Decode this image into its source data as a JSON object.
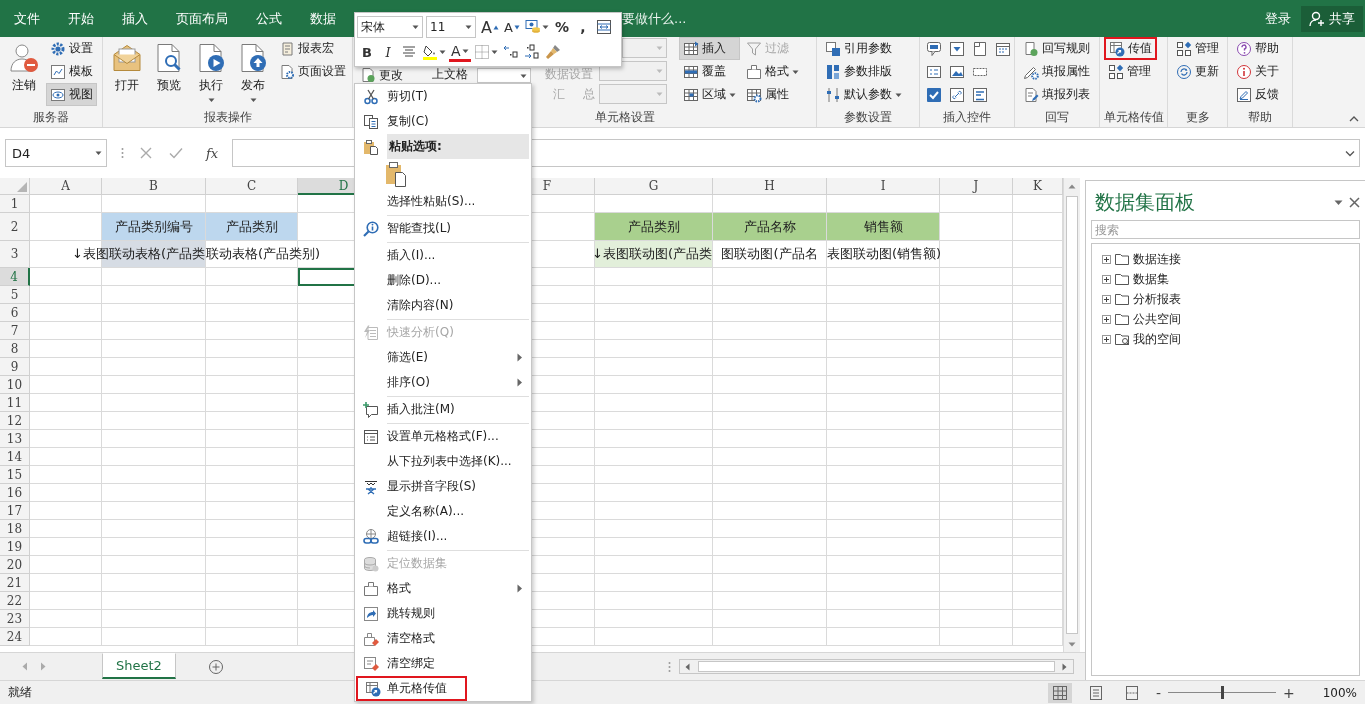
{
  "title_bar": {
    "tabs": [
      {
        "label": "文件",
        "selected": false
      },
      {
        "label": "开始",
        "selected": false
      },
      {
        "label": "插入",
        "selected": false
      },
      {
        "label": "页面布局",
        "selected": false
      },
      {
        "label": "公式",
        "selected": false
      },
      {
        "label": "数据",
        "selected": false
      }
    ],
    "tell_me": "要做什么...",
    "sign_in": "登录",
    "share": "共享"
  },
  "ribbon": {
    "groups": [
      {
        "kind": "buttons",
        "label": "服务器",
        "columns": [
          {
            "kind": "large",
            "buttons": [
              {
                "text": "注销",
                "pressed": false,
                "dropdown": false
              }
            ]
          },
          {
            "kind": "small",
            "buttons": [
              {
                "text": "设置",
                "pressed": false,
                "dropdown": false
              },
              {
                "text": "模板",
                "pressed": false,
                "dropdown": false
              },
              {
                "text": "视图",
                "pressed": true,
                "dropdown": false
              }
            ]
          }
        ]
      },
      {
        "kind": "buttons",
        "label": "报表操作",
        "columns": [
          {
            "kind": "large",
            "buttons": [
              {
                "text": "打开",
                "pressed": false,
                "dropdown": false
              }
            ]
          },
          {
            "kind": "large",
            "buttons": [
              {
                "text": "预览",
                "pressed": false,
                "dropdown": false
              }
            ]
          },
          {
            "kind": "large",
            "buttons": [
              {
                "text": "执行",
                "pressed": false,
                "dropdown": true
              }
            ]
          },
          {
            "kind": "large",
            "buttons": [
              {
                "text": "发布",
                "pressed": false,
                "dropdown": true
              }
            ]
          },
          {
            "kind": "small",
            "buttons": [
              {
                "text": "报表宏",
                "pressed": false,
                "dropdown": false
              },
              {
                "text": "页面设置",
                "pressed": false,
                "dropdown": false
              }
            ]
          }
        ]
      },
      {
        "kind": "fields",
        "label": "单元格设置",
        "fields": [
          {
            "kind": "button",
            "text": "更改",
            "disabled": false
          },
          {
            "kind": "label",
            "text": "上文格",
            "disabled": false
          },
          {
            "kind": "dropdown",
            "disabled": false
          },
          {
            "kind": "label",
            "text": "数据设置",
            "disabled": true
          },
          {
            "kind": "label",
            "text": "汇",
            "disabled": true
          },
          {
            "kind": "label",
            "text": "总",
            "disabled": true
          },
          {
            "kind": "dropdown",
            "disabled": true
          },
          {
            "kind": "dropdown",
            "disabled": true
          },
          {
            "kind": "dropdown",
            "disabled": true
          }
        ],
        "columns": [
          {
            "kind": "small",
            "buttons": [
              {
                "text": "插入",
                "pressed": true,
                "dropdown": false
              },
              {
                "text": "覆盖",
                "pressed": false,
                "dropdown": false
              },
              {
                "text": "区域",
                "pressed": false,
                "dropdown": true
              }
            ]
          },
          {
            "kind": "small",
            "buttons": [
              {
                "text": "过滤",
                "pressed": false,
                "dropdown": false,
                "disabled": true
              },
              {
                "text": "格式",
                "pressed": false,
                "dropdown": true,
                "disabled": false
              },
              {
                "text": "属性",
                "pressed": false,
                "dropdown": false,
                "disabled": false
              }
            ]
          }
        ]
      },
      {
        "kind": "buttons",
        "label": "参数设置",
        "columns": [
          {
            "kind": "small",
            "buttons": [
              {
                "text": "引用参数",
                "pressed": false,
                "dropdown": false
              },
              {
                "text": "参数排版",
                "pressed": false,
                "dropdown": false
              },
              {
                "text": "默认参数",
                "pressed": false,
                "dropdown": true
              }
            ]
          }
        ]
      },
      {
        "kind": "buttons",
        "label": "插入控件",
        "columns": [
          {
            "kind": "icons",
            "buttons": [
              {
                "pressed": false
              },
              {
                "pressed": false
              },
              {
                "pressed": false
              }
            ]
          },
          {
            "kind": "icons",
            "buttons": [
              {
                "pressed": false
              },
              {
                "pressed": false
              },
              {
                "pressed": false
              }
            ]
          },
          {
            "kind": "icons",
            "buttons": [
              {
                "pressed": false
              },
              {
                "pressed": false
              },
              {
                "pressed": false
              }
            ]
          },
          {
            "kind": "icons",
            "buttons": [
              {
                "pressed": false
              }
            ]
          }
        ]
      },
      {
        "kind": "buttons",
        "label": "回写",
        "columns": [
          {
            "kind": "small",
            "buttons": [
              {
                "text": "回写规则",
                "pressed": false,
                "dropdown": false
              },
              {
                "text": "填报属性",
                "pressed": false,
                "dropdown": false
              },
              {
                "text": "填报列表",
                "pressed": false,
                "dropdown": false
              }
            ]
          }
        ]
      },
      {
        "kind": "buttons",
        "label": "单元格传值",
        "columns": [
          {
            "kind": "small",
            "buttons": [
              {
                "text": "传值",
                "pressed": false,
                "dropdown": false,
                "highlighted": true
              },
              {
                "text": "管理",
                "pressed": false,
                "dropdown": false,
                "highlighted": false
              }
            ]
          }
        ]
      },
      {
        "kind": "buttons",
        "label": "更多",
        "columns": [
          {
            "kind": "small",
            "buttons": [
              {
                "text": "管理",
                "pressed": false,
                "dropdown": false
              },
              {
                "text": "更新",
                "pressed": false,
                "dropdown": false
              }
            ]
          }
        ]
      },
      {
        "kind": "buttons",
        "label": "帮助",
        "columns": [
          {
            "kind": "small",
            "buttons": [
              {
                "text": "帮助",
                "pressed": false,
                "dropdown": false
              },
              {
                "text": "关于",
                "pressed": false,
                "dropdown": false
              },
              {
                "text": "反馈",
                "pressed": false,
                "dropdown": false
              }
            ]
          }
        ]
      }
    ]
  },
  "mini_toolbar": {
    "font": "宋体",
    "size": "11",
    "row_1": [
      {
        "kind": "text",
        "text": "A",
        "dropdown": false
      },
      {
        "kind": "text",
        "text": "A",
        "dropdown": false
      },
      {
        "kind": "icon",
        "dropdown": true
      },
      {
        "kind": "text",
        "text": "%",
        "dropdown": false
      },
      {
        "kind": "text",
        "text": ",",
        "dropdown": false
      },
      {
        "kind": "icon",
        "dropdown": false
      }
    ],
    "row_2": [
      {
        "kind": "text",
        "text": "B",
        "dropdown": false
      },
      {
        "kind": "text",
        "text": "I",
        "dropdown": false
      },
      {
        "kind": "icon",
        "dropdown": false
      },
      {
        "kind": "icon",
        "dropdown": true
      },
      {
        "kind": "text",
        "text": "A",
        "dropdown": true
      },
      {
        "kind": "icon",
        "dropdown": true
      },
      {
        "kind": "icon",
        "dropdown": false
      },
      {
        "kind": "icon",
        "dropdown": false
      },
      {
        "kind": "icon",
        "dropdown": false
      }
    ]
  },
  "formula_bar": {
    "name_box": "D4",
    "function_label": "fx"
  },
  "sheet": {
    "columns": [
      {
        "label": "A",
        "selected": false
      },
      {
        "label": "B",
        "selected": false
      },
      {
        "label": "C",
        "selected": false
      },
      {
        "label": "D",
        "selected": true
      },
      {
        "label": "F",
        "selected": false
      },
      {
        "label": "G",
        "selected": false
      },
      {
        "label": "H",
        "selected": false
      },
      {
        "label": "I",
        "selected": false
      },
      {
        "label": "J",
        "selected": false
      },
      {
        "label": "K",
        "selected": false
      }
    ],
    "rows": [
      {
        "number": "1",
        "selected": false
      },
      {
        "number": "2",
        "selected": false,
        "cells": [
          {
            "kind": "empty"
          },
          {
            "kind": "blue-header",
            "text": "产品类别编号",
            "cut_start": false,
            "cut_end": false
          },
          {
            "kind": "blue-header",
            "text": "产品类别",
            "cut_start": false,
            "cut_end": false
          },
          {
            "kind": "empty"
          },
          {
            "kind": "empty"
          },
          {
            "kind": "empty"
          },
          {
            "kind": "green-header",
            "text": "产品类别",
            "cut_start": false,
            "cut_end": false
          },
          {
            "kind": "green-header",
            "text": "产品名称",
            "cut_start": false,
            "cut_end": false
          },
          {
            "kind": "green-header",
            "text": "销售额",
            "cut_start": false,
            "cut_end": false
          },
          {
            "kind": "empty"
          },
          {
            "kind": "empty"
          }
        ]
      },
      {
        "number": "3",
        "selected": false,
        "cells": [
          {
            "kind": "empty"
          },
          {
            "kind": "blue-formula",
            "text": "↓表图联动表格(产品类",
            "cut_start": false,
            "cut_end": true
          },
          {
            "kind": "plain",
            "text": "联动表格(产品类别)",
            "cut_start": true,
            "cut_end": false
          },
          {
            "kind": "empty"
          },
          {
            "kind": "empty"
          },
          {
            "kind": "empty"
          },
          {
            "kind": "green-formula",
            "text": "↓表图联动图(产品类",
            "cut_start": false,
            "cut_end": true
          },
          {
            "kind": "plain",
            "text": "图联动图(产品名",
            "cut_start": true,
            "cut_end": true
          },
          {
            "kind": "plain",
            "text": "表图联动图(销售额)",
            "cut_start": true,
            "cut_end": false
          },
          {
            "kind": "empty"
          },
          {
            "kind": "empty"
          }
        ]
      },
      {
        "number": "4",
        "selected": true
      },
      {
        "number": "5",
        "selected": false
      },
      {
        "number": "6",
        "selected": false
      },
      {
        "number": "7",
        "selected": false
      },
      {
        "number": "8",
        "selected": false
      },
      {
        "number": "9",
        "selected": false
      },
      {
        "number": "10",
        "selected": false
      },
      {
        "number": "11",
        "selected": false
      },
      {
        "number": "12",
        "selected": false
      },
      {
        "number": "13",
        "selected": false
      },
      {
        "number": "14",
        "selected": false
      },
      {
        "number": "15",
        "selected": false
      },
      {
        "number": "16",
        "selected": false
      },
      {
        "number": "17",
        "selected": false
      },
      {
        "number": "18",
        "selected": false
      },
      {
        "number": "19",
        "selected": false
      },
      {
        "number": "20",
        "selected": false
      },
      {
        "number": "21",
        "selected": false
      },
      {
        "number": "22",
        "selected": false
      },
      {
        "number": "23",
        "selected": false
      },
      {
        "number": "24",
        "selected": false
      }
    ],
    "tabs": [
      {
        "label": "Sheet2",
        "selected": true
      }
    ]
  },
  "context_menu": {
    "items": [
      {
        "kind": "item",
        "text": "剪切(T)",
        "disabled": false,
        "highlighted": false
      },
      {
        "kind": "item",
        "text": "复制(C)",
        "disabled": false,
        "highlighted": false
      },
      {
        "kind": "header",
        "text": "粘贴选项:"
      },
      {
        "kind": "paste-option"
      },
      {
        "kind": "item",
        "text": "选择性粘贴(S)...",
        "disabled": false,
        "highlighted": false
      },
      {
        "kind": "separator"
      },
      {
        "kind": "item",
        "text": "智能查找(L)",
        "disabled": false,
        "highlighted": false
      },
      {
        "kind": "separator"
      },
      {
        "kind": "item",
        "text": "插入(I)...",
        "disabled": false,
        "highlighted": false
      },
      {
        "kind": "item",
        "text": "删除(D)...",
        "disabled": false,
        "highlighted": false
      },
      {
        "kind": "item",
        "text": "清除内容(N)",
        "disabled": false,
        "highlighted": false
      },
      {
        "kind": "separator"
      },
      {
        "kind": "item",
        "text": "快速分析(Q)",
        "disabled": true,
        "highlighted": false
      },
      {
        "kind": "submenu",
        "text": "筛选(E)",
        "disabled": false,
        "highlighted": false
      },
      {
        "kind": "submenu",
        "text": "排序(O)",
        "disabled": false,
        "highlighted": false
      },
      {
        "kind": "separator"
      },
      {
        "kind": "item",
        "text": "插入批注(M)",
        "disabled": false,
        "highlighted": false
      },
      {
        "kind": "separator"
      },
      {
        "kind": "item",
        "text": "设置单元格格式(F)...",
        "disabled": false,
        "highlighted": false
      },
      {
        "kind": "item",
        "text": "从下拉列表中选择(K)...",
        "disabled": false,
        "highlighted": false
      },
      {
        "kind": "item",
        "text": "显示拼音字段(S)",
        "disabled": false,
        "highlighted": false
      },
      {
        "kind": "item",
        "text": "定义名称(A)...",
        "disabled": false,
        "highlighted": false
      },
      {
        "kind": "item",
        "text": "超链接(I)...",
        "disabled": false,
        "highlighted": false
      },
      {
        "kind": "separator"
      },
      {
        "kind": "item",
        "text": "定位数据集",
        "disabled": true,
        "highlighted": false
      },
      {
        "kind": "submenu",
        "text": "格式",
        "disabled": false,
        "highlighted": false
      },
      {
        "kind": "item",
        "text": "跳转规则",
        "disabled": false,
        "highlighted": false
      },
      {
        "kind": "item",
        "text": "清空格式",
        "disabled": false,
        "highlighted": false
      },
      {
        "kind": "item",
        "text": "清空绑定",
        "disabled": false,
        "highlighted": false
      },
      {
        "kind": "item",
        "text": "单元格传值",
        "disabled": false,
        "highlighted": true
      }
    ]
  },
  "dataset_panel": {
    "title": "数据集面板",
    "search": {
      "placeholder": "搜索"
    },
    "tree": [
      {
        "label": "数据连接",
        "expanded": false
      },
      {
        "label": "数据集",
        "expanded": false
      },
      {
        "label": "分析报表",
        "expanded": false
      },
      {
        "label": "公共空间",
        "expanded": false
      },
      {
        "label": "我的空间",
        "expanded": false
      }
    ]
  },
  "status_bar": {
    "text": "就绪",
    "views": [
      {
        "selected": true
      },
      {
        "selected": false
      },
      {
        "selected": false
      }
    ],
    "zoom": {
      "minus": "-",
      "plus": "+",
      "level": 0.5,
      "reading": "100%"
    }
  }
}
